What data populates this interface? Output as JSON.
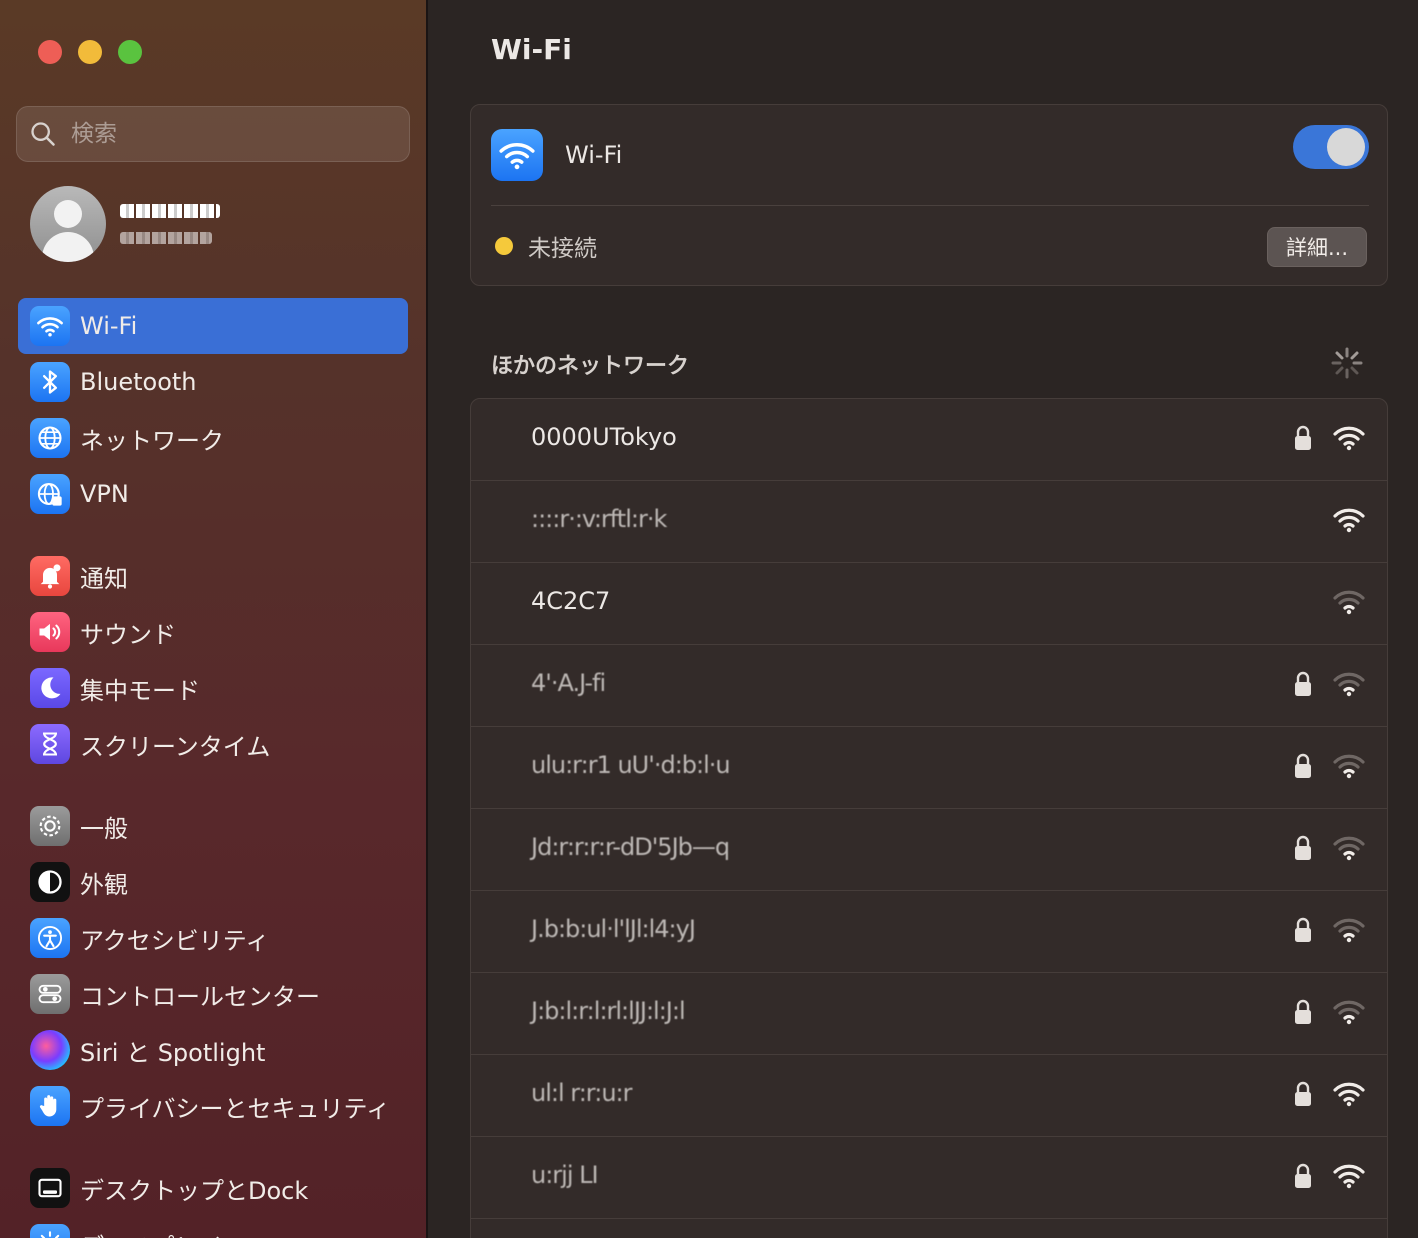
{
  "sidebar": {
    "search_placeholder": "検索",
    "account": {
      "name": "▀▀▀▀▀▀",
      "subtitle": "Apple ID"
    },
    "groups": [
      [
        {
          "label": "Wi-Fi",
          "icon": "wifi-icon",
          "active": true
        },
        {
          "label": "Bluetooth",
          "icon": "bluetooth-icon"
        },
        {
          "label": "ネットワーク",
          "icon": "globe-icon"
        },
        {
          "label": "VPN",
          "icon": "vpn-globe-icon"
        }
      ],
      [
        {
          "label": "通知",
          "icon": "bell-icon"
        },
        {
          "label": "サウンド",
          "icon": "speaker-icon"
        },
        {
          "label": "集中モード",
          "icon": "moon-icon"
        },
        {
          "label": "スクリーンタイム",
          "icon": "hourglass-icon"
        }
      ],
      [
        {
          "label": "一般",
          "icon": "gear-icon"
        },
        {
          "label": "外観",
          "icon": "appearance-icon"
        },
        {
          "label": "アクセシビリティ",
          "icon": "accessibility-icon"
        },
        {
          "label": "コントロールセンター",
          "icon": "toggles-icon"
        },
        {
          "label": "Siri と Spotlight",
          "icon": "siri-icon"
        },
        {
          "label": "プライバシーとセキュリティ",
          "icon": "hand-icon"
        }
      ],
      [
        {
          "label": "デスクトップとDock",
          "icon": "dock-icon"
        },
        {
          "label": "ディスプレイ",
          "icon": "display-icon"
        }
      ]
    ]
  },
  "main": {
    "title": "Wi-Fi",
    "wifi": {
      "label": "Wi-Fi",
      "enabled": true,
      "status": "未接続",
      "details_button": "詳細..."
    },
    "other_networks_title": "ほかのネットワーク",
    "networks": [
      {
        "name": "0000UTokyo",
        "locked": true,
        "strength": "strong",
        "redacted": false
      },
      {
        "name": "::::r·:v:rftl:r·k",
        "locked": false,
        "strength": "strong",
        "redacted": true
      },
      {
        "name": "4C2C7"
      },
      {
        "name": "4'·A.J-fi",
        "locked": true,
        "strength": "weak",
        "redacted": true
      },
      {
        "name": "ulu:r:r1 uU'·d:b:l·u",
        "locked": true,
        "strength": "weak",
        "redacted": true
      },
      {
        "name": "Jd:r:r:r:r-dD'5Jb—q",
        "locked": true,
        "strength": "weak",
        "redacted": true
      },
      {
        "name": "J.b:b:ul·l'lJl:l4:yJ",
        "locked": true,
        "strength": "weak",
        "redacted": true
      },
      {
        "name": "J:b:l:r:l:rl:lJJ:l:J:l",
        "locked": true,
        "strength": "weak",
        "redacted": true
      },
      {
        "name": "ul:l r:r:u:r",
        "locked": true,
        "strength": "strong",
        "redacted": true
      },
      {
        "name": "u:rjj LI",
        "locked": true,
        "strength": "strong",
        "redacted": true
      }
    ]
  },
  "colors": {
    "accent": "#3a6fd6",
    "status_dot": "#f5c93b"
  }
}
